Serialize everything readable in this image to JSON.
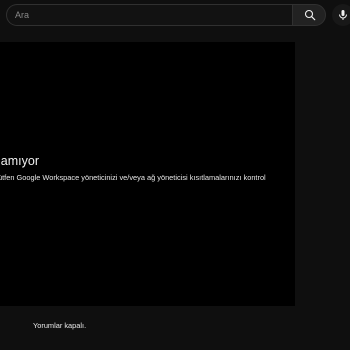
{
  "search": {
    "placeholder": "Ara",
    "value": ""
  },
  "header": {
    "search_icon": "search-icon",
    "mic_icon": "microphone-icon"
  },
  "player": {
    "error_title": "lamıyor",
    "error_message": "ütfen Google Workspace yöneticinizi ve/veya ağ yöneticisi kısıtlamalarınızı kontrol"
  },
  "comments": {
    "status": "Yorumlar kapalı."
  }
}
